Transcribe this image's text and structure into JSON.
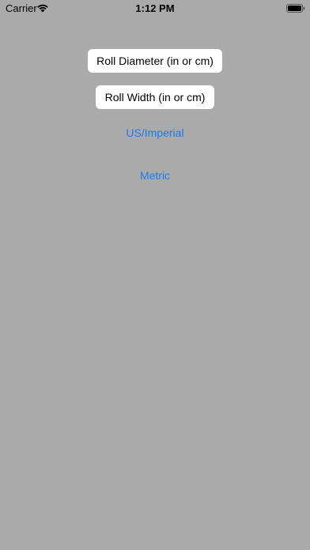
{
  "status_bar": {
    "carrier": "Carrier",
    "time": "1:12 PM"
  },
  "buttons": {
    "roll_diameter": "Roll Diameter (in or cm)",
    "roll_width": "Roll Width (in or cm)"
  },
  "links": {
    "us_imperial": "US/Imperial",
    "metric": "Metric"
  },
  "colors": {
    "background": "#aaaaaa",
    "link": "#1a7cf0",
    "button": "#ffffff"
  }
}
